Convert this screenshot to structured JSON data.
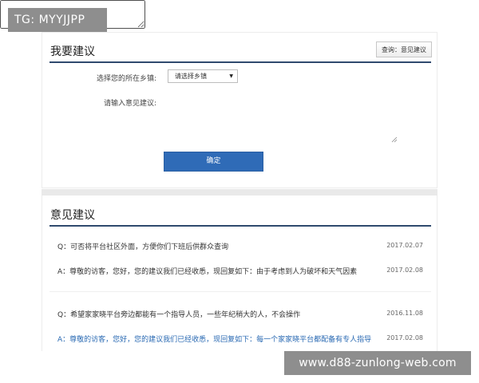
{
  "overlay": {
    "tag_text": "TG: MYYJJPP",
    "site_text": "www.d88-zunlong-web.com"
  },
  "form_section": {
    "title": "我要建议",
    "query_button_label": "查询：意见建议",
    "town_label": "选择您的所在乡镇:",
    "town_select_value": "请选择乡镇",
    "suggestion_label": "请输入意见建议:",
    "suggestion_value": "",
    "confirm_button_label": "确定"
  },
  "list_section": {
    "title": "意见建议",
    "items": [
      {
        "question": "Q：可否将平台社区外面，方便你们下班后供群众查询",
        "question_date": "2017.02.07",
        "answer": "A：尊敬的访客，您好，您的建议我们已经收悉，现回复如下：由于考虑到人为破坏和天气因素",
        "answer_date": "2017.02.08"
      },
      {
        "question": "Q：希望家家晓平台旁边都能有一个指导人员，一些年纪稍大的人，不会操作",
        "question_date": "2016.11.08",
        "answer": "A：尊敬的访客，您好，您的建议我们已经收悉，现回复如下：每一个家家晓平台都配备有专人指导",
        "answer_date": "2017.02.08"
      }
    ]
  },
  "colors": {
    "accent": "#2f6bb7",
    "title_underline": "#2f4a6e",
    "answer_link": "#2a6ab3"
  }
}
